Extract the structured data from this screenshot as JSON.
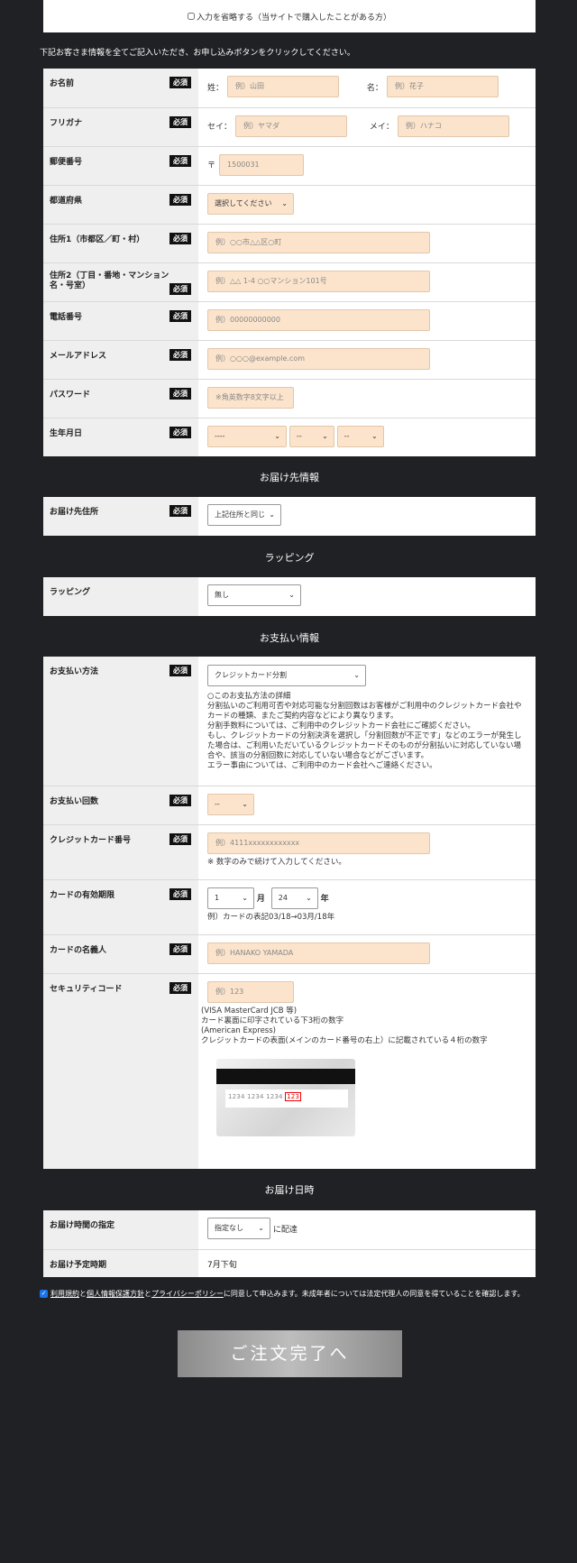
{
  "skip": {
    "label": "入力を省略する（当サイトで購入したことがある方）"
  },
  "intro": "下記お客さま情報を全てご記入いただき、お申し込みボタンをクリックしてください。",
  "required_badge": "必須",
  "customer": {
    "name": {
      "label": "お名前",
      "sei": "姓：",
      "mei": "名：",
      "sei_ph": "例）山田",
      "mei_ph": "例）花子"
    },
    "kana": {
      "label": "フリガナ",
      "sei": "セイ：",
      "mei": "メイ：",
      "sei_ph": "例）ヤマダ",
      "mei_ph": "例）ハナコ"
    },
    "zip": {
      "label": "郵便番号",
      "prefix": "〒",
      "ph": "1500031"
    },
    "pref": {
      "label": "都道府県",
      "value": "選択してください"
    },
    "addr1": {
      "label": "住所1（市都区／町・村）",
      "ph": "例）○○市△△区○町"
    },
    "addr2": {
      "label": "住所2（丁目・番地・マンション名・号室）",
      "ph": "例）△△ 1-4 ○○マンション101号"
    },
    "tel": {
      "label": "電話番号",
      "ph": "例）00000000000"
    },
    "email": {
      "label": "メールアドレス",
      "ph": "例）○○○@example.com"
    },
    "password": {
      "label": "パスワード",
      "ph": "※角英数字8文字以上"
    },
    "birth": {
      "label": "生年月日",
      "year": "----",
      "month": "--",
      "day": "--"
    }
  },
  "delivery": {
    "title": "お届け先情報",
    "label": "お届け先住所",
    "value": "上記住所と同じ"
  },
  "wrapping": {
    "title": "ラッピング",
    "label": "ラッピング",
    "value": "無し"
  },
  "payment": {
    "title": "お支払い情報",
    "method": {
      "label": "お支払い方法",
      "value": "クレジットカード分割",
      "details": [
        "○このお支払方法の詳細",
        "分割払いのご利用可否や対応可能な分割回数はお客様がご利用中のクレジットカード会社やカードの種類、またご契約内容などにより異なります。",
        "分割手数料については、ご利用中のクレジットカード会社にご確認ください。",
        "もし、クレジットカードの分割決済を選択し「分割回数が不正です」などのエラーが発生した場合は、ご利用いただいているクレジットカードそのものが分割払いに対応していない場合や、該当の分割回数に対応していない場合などがございます。",
        "エラー事由については、ご利用中のカード会社へご連絡ください。"
      ]
    },
    "count": {
      "label": "お支払い回数",
      "value": "--"
    },
    "card_no": {
      "label": "クレジットカード番号",
      "ph": "例）4111xxxxxxxxxxxx",
      "note": "※ 数字のみで続けて入力してください。"
    },
    "expiry": {
      "label": "カードの有効期限",
      "month": "1",
      "month_unit": "月",
      "year": "24",
      "year_unit": "年",
      "note": "例）カードの表記03/18→03月/18年"
    },
    "holder": {
      "label": "カードの名義人",
      "ph": "例）HANAKO YAMADA"
    },
    "cvv": {
      "label": "セキュリティコード",
      "ph": "例）123",
      "notes": [
        "(VISA MasterCard JCB 等)",
        "カード裏面に印字されている下3桁の数字",
        "(American Express)",
        "クレジットカードの表面(メインのカード番号の右上）に記載されている４桁の数字"
      ],
      "card_numbers": "1234  1234  1234",
      "card_cvv": "123"
    }
  },
  "shipping": {
    "title": "お届け日時",
    "time": {
      "label": "お届け時間の指定",
      "value": "指定なし",
      "suffix": "に配達"
    },
    "date": {
      "label": "お届け予定時期",
      "value": "7月下旬"
    }
  },
  "agree": {
    "link1": "利用規約",
    "and1": "と",
    "link2": "個人情報保護方針",
    "and2": "と",
    "link3": "プライバシーポリシー",
    "rest": "に同意して申込みます。未成年者については法定代理人の同意を得ていることを確認します。"
  },
  "submit": "ご注文完了へ"
}
